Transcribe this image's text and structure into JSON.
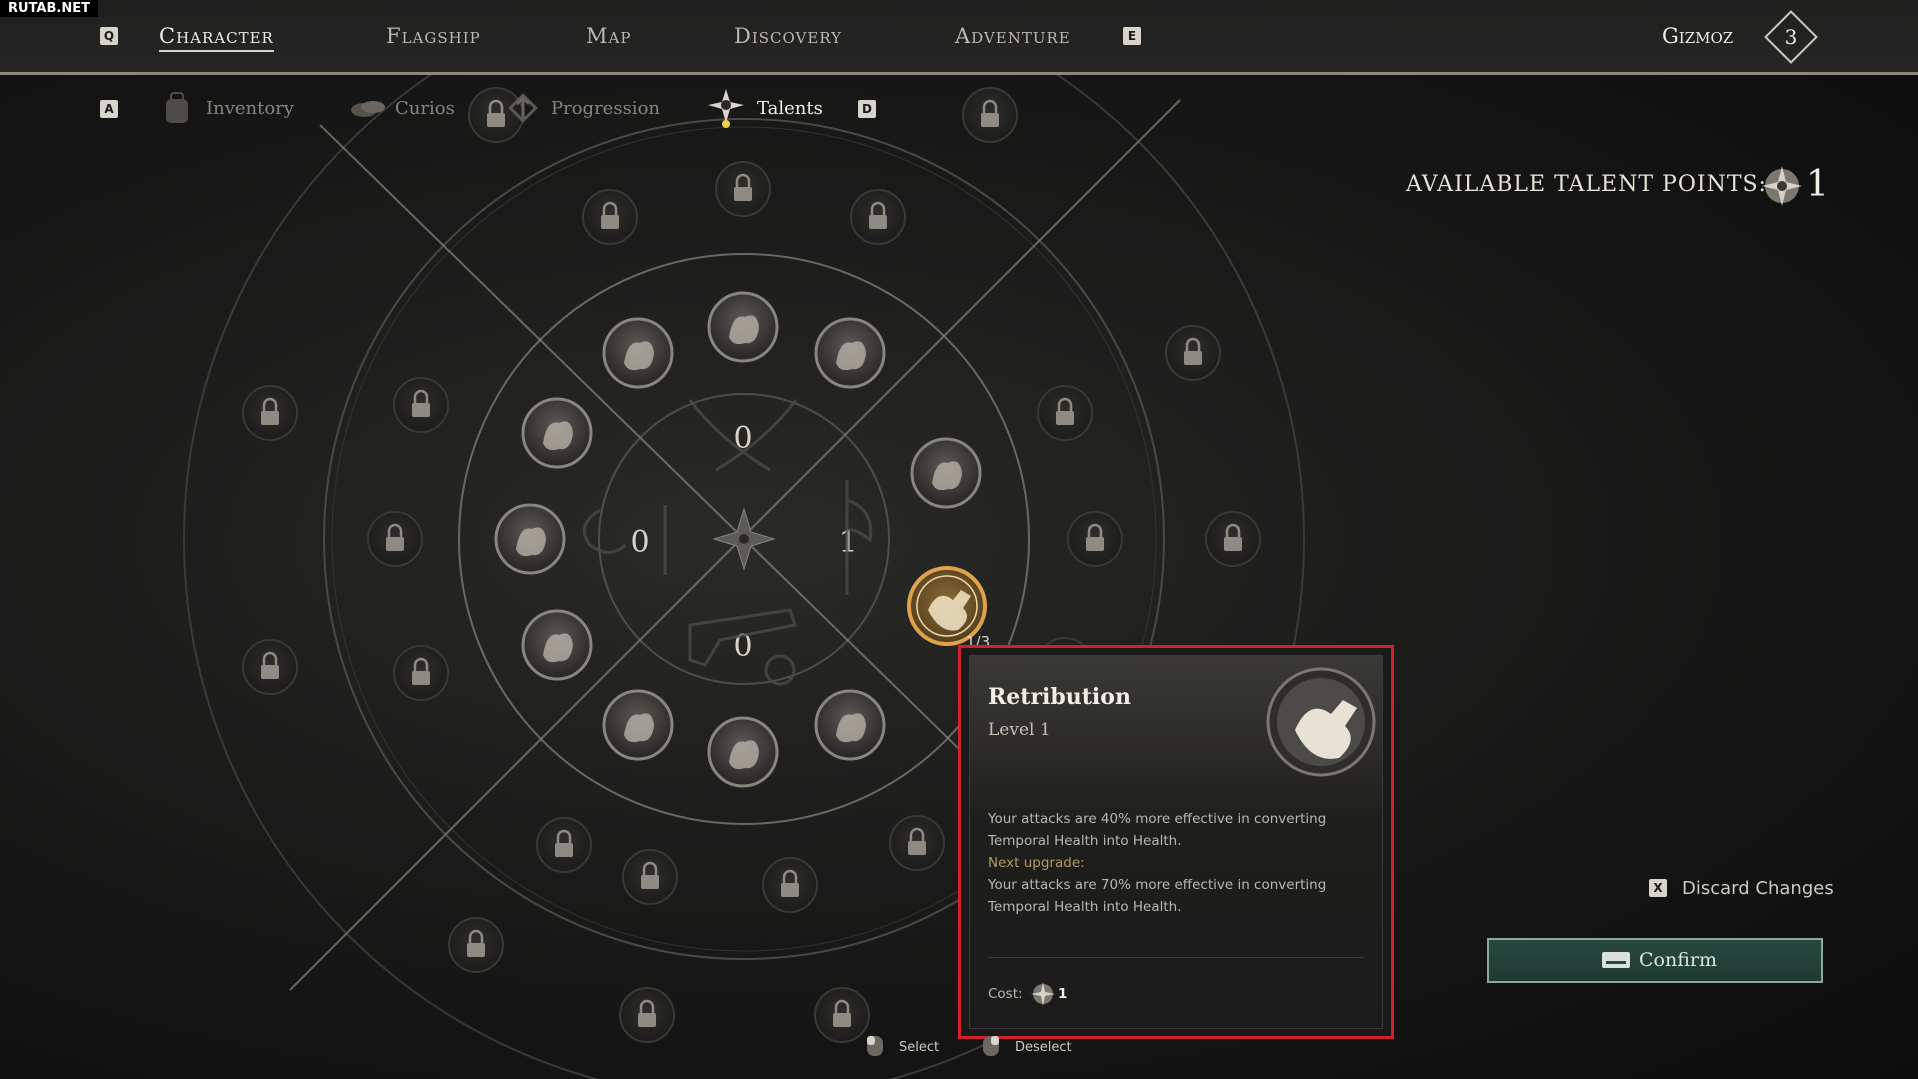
{
  "watermark": "RUTAB.NET",
  "topnav": {
    "left_key": "Q",
    "right_key": "E",
    "tabs": [
      "Character",
      "Flagship",
      "Map",
      "Discovery",
      "Adventure"
    ],
    "active": "Character",
    "player_name": "Gizmoz",
    "player_rank": "3"
  },
  "subnav": {
    "left_key": "A",
    "right_key": "D",
    "items": [
      "Inventory",
      "Curios",
      "Progression",
      "Talents"
    ],
    "active": "Talents"
  },
  "talent_points": {
    "label": "AVAILABLE TALENT POINTS:",
    "value": "1"
  },
  "wheel": {
    "quadrant_counts": {
      "top": "0",
      "left": "0",
      "right": "1",
      "bottom": "0"
    },
    "selected_progress": "1/3"
  },
  "tooltip": {
    "title": "Retribution",
    "level": "Level 1",
    "description": "Your attacks are 40% more effective in converting Temporal Health into Health.",
    "next_label": "Next upgrade:",
    "next_description": "Your attacks are 70% more effective in converting Temporal Health into Health.",
    "cost_label": "Cost:",
    "cost_value": "1"
  },
  "actions": {
    "discard_key": "X",
    "discard_label": "Discard Changes",
    "confirm_label": "Confirm"
  },
  "hints": {
    "select": "Select",
    "deselect": "Deselect"
  },
  "colors": {
    "highlight_border": "#d1222c",
    "confirm_bg": "#28483f",
    "selected_talent": "#c99b45"
  }
}
